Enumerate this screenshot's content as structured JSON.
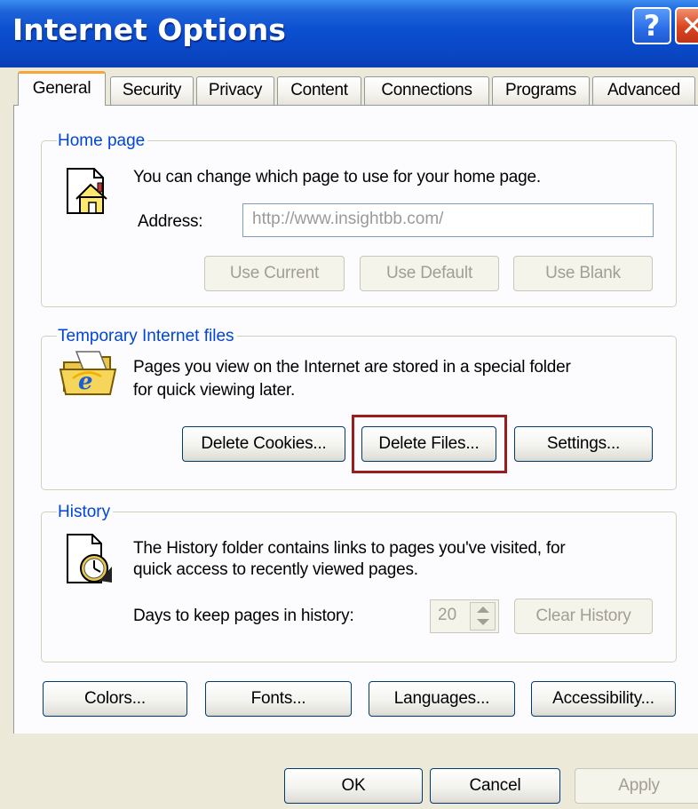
{
  "window": {
    "title": "Internet Options",
    "help_glyph": "?",
    "close_glyph": "✕"
  },
  "tabs": [
    {
      "label": "General",
      "active": true
    },
    {
      "label": "Security"
    },
    {
      "label": "Privacy"
    },
    {
      "label": "Content"
    },
    {
      "label": "Connections"
    },
    {
      "label": "Programs"
    },
    {
      "label": "Advanced"
    }
  ],
  "home_page": {
    "legend": "Home page",
    "icon": "home-page-icon",
    "description": "You can change which page to use for your home page.",
    "address_label": "Address:",
    "address_value": "http://www.insightbb.com/",
    "use_current": "Use Current",
    "use_default": "Use Default",
    "use_blank": "Use Blank"
  },
  "temp_files": {
    "legend": "Temporary Internet files",
    "icon": "ie-folder-icon",
    "description_line1": "Pages you view on the Internet are stored in a special folder",
    "description_line2": "for quick viewing later.",
    "delete_cookies": "Delete Cookies...",
    "delete_files": "Delete Files...",
    "settings": "Settings..."
  },
  "history": {
    "legend": "History",
    "icon": "history-clock-icon",
    "description_line1": "The History folder contains links to pages you've visited, for",
    "description_line2": "quick access to recently viewed pages.",
    "days_label": "Days to keep pages in history:",
    "days_value": "20",
    "clear_history": "Clear History"
  },
  "bottom_buttons": {
    "colors": "Colors...",
    "fonts": "Fonts...",
    "languages": "Languages...",
    "accessibility": "Accessibility..."
  },
  "dialog_buttons": {
    "ok": "OK",
    "cancel": "Cancel",
    "apply": "Apply"
  },
  "colors": {
    "title_bar": "#0a46c4",
    "group_legend": "#0046d5",
    "active_tab_accent": "#f5a53a",
    "highlight_box": "#9a1c1c"
  }
}
